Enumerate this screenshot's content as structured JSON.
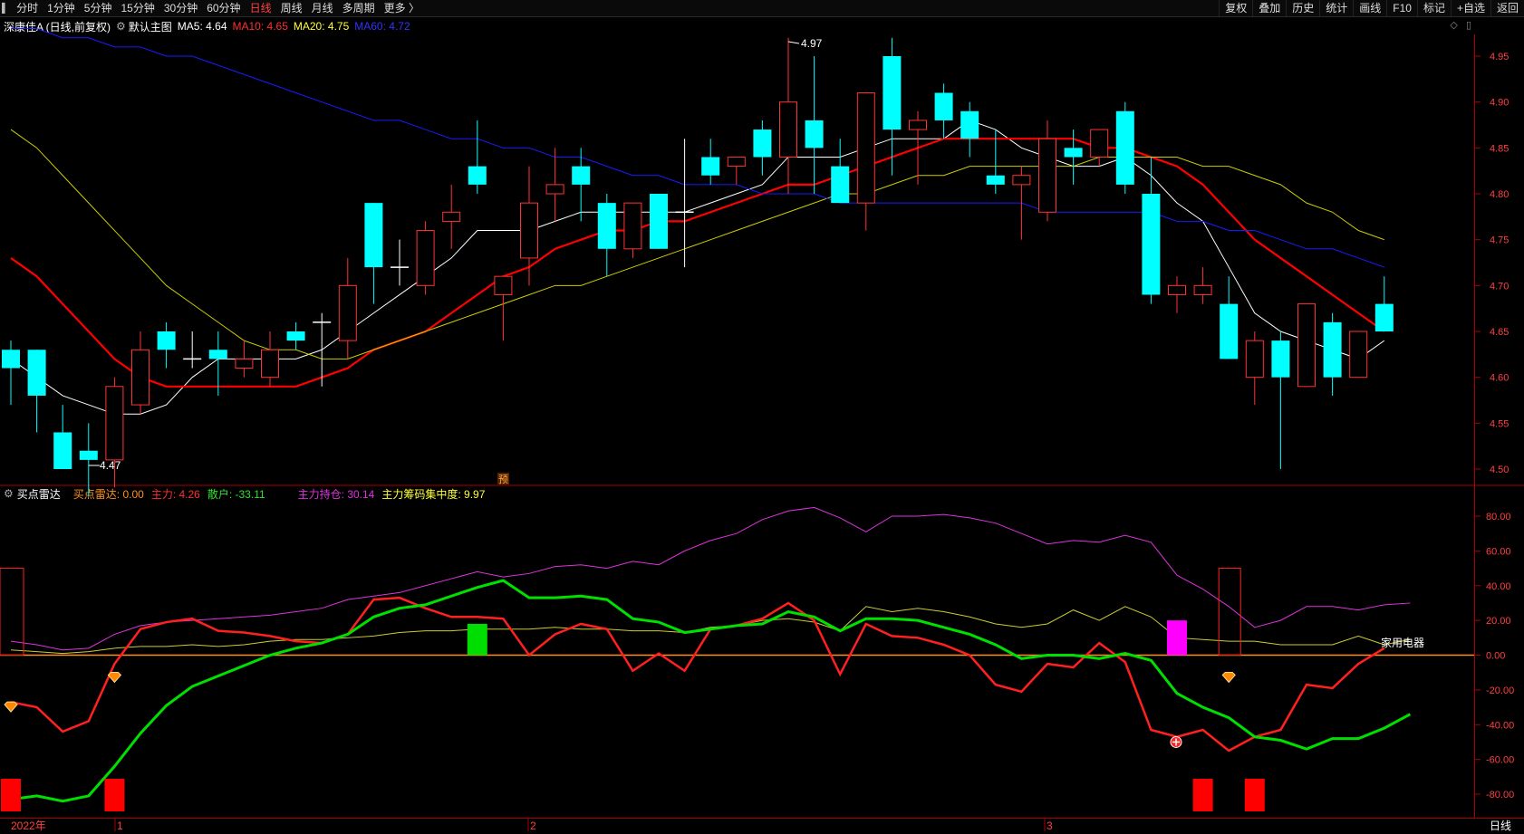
{
  "toolbar": {
    "tabs": [
      "分时",
      "1分钟",
      "5分钟",
      "15分钟",
      "30分钟",
      "60分钟",
      "日线",
      "周线",
      "月线",
      "多周期",
      "更多 〉"
    ],
    "active": "日线",
    "right_buttons": [
      "复权",
      "叠加",
      "历史",
      "统计",
      "画线",
      "F10",
      "标记",
      "+自选",
      "返回"
    ]
  },
  "header": {
    "stock": "深康佳A (日线,前复权)",
    "template": "默认主图",
    "ma5": "MA5: 4.64",
    "ma10": "MA10: 4.65",
    "ma20": "MA20: 4.75",
    "ma60": "MA60: 4.72"
  },
  "indicator_header": {
    "name": "买点雷达",
    "signal": "买点雷达: 0.00",
    "zhuli": "主力: 4.26",
    "sanhu": "散户: -33.11",
    "chicang": "主力持仓: 30.14",
    "jizhong": "主力筹码集中度: 9.97"
  },
  "annotations": {
    "high": "4.97",
    "low": "4.47",
    "pre": "预",
    "sector": "家用电器"
  },
  "bottom": {
    "year": "2022年",
    "months": [
      "1",
      "2",
      "3"
    ],
    "period": "日线"
  },
  "colors": {
    "up": "#ff3333",
    "down": "#00ffff",
    "ma5": "#ffffff",
    "ma10": "#ff0000",
    "ma20": "#cccc00",
    "ma60": "#1a1aff",
    "zhuli": "#ff2020",
    "sanhu": "#00e000",
    "chicang": "#dd33dd",
    "jizhong": "#cccc33",
    "border": "#aa0000"
  },
  "chart_data": [
    {
      "type": "candlestick",
      "price_axis": [
        "4.95",
        "4.90",
        "4.85",
        "4.80",
        "4.75",
        "4.70",
        "4.65",
        "4.60",
        "4.55",
        "4.50"
      ],
      "ylim": [
        4.455,
        5.0
      ],
      "candles": [
        {
          "o": 4.63,
          "h": 4.64,
          "l": 4.57,
          "c": 4.61
        },
        {
          "o": 4.63,
          "h": 4.63,
          "l": 4.54,
          "c": 4.58
        },
        {
          "o": 4.54,
          "h": 4.57,
          "l": 4.5,
          "c": 4.5
        },
        {
          "o": 4.52,
          "h": 4.55,
          "l": 4.47,
          "c": 4.51
        },
        {
          "o": 4.51,
          "h": 4.6,
          "l": 4.48,
          "c": 4.59
        },
        {
          "o": 4.57,
          "h": 4.65,
          "l": 4.56,
          "c": 4.63
        },
        {
          "o": 4.65,
          "h": 4.66,
          "l": 4.61,
          "c": 4.63
        },
        {
          "o": 4.62,
          "h": 4.65,
          "l": 4.61,
          "c": 4.62
        },
        {
          "o": 4.63,
          "h": 4.65,
          "l": 4.58,
          "c": 4.62
        },
        {
          "o": 4.61,
          "h": 4.64,
          "l": 4.6,
          "c": 4.62
        },
        {
          "o": 4.6,
          "h": 4.65,
          "l": 4.59,
          "c": 4.63
        },
        {
          "o": 4.65,
          "h": 4.66,
          "l": 4.63,
          "c": 4.64
        },
        {
          "o": 4.66,
          "h": 4.67,
          "l": 4.59,
          "c": 4.66
        },
        {
          "o": 4.64,
          "h": 4.73,
          "l": 4.62,
          "c": 4.7
        },
        {
          "o": 4.79,
          "h": 4.79,
          "l": 4.68,
          "c": 4.72
        },
        {
          "o": 4.72,
          "h": 4.75,
          "l": 4.7,
          "c": 4.72
        },
        {
          "o": 4.7,
          "h": 4.77,
          "l": 4.69,
          "c": 4.76
        },
        {
          "o": 4.77,
          "h": 4.81,
          "l": 4.74,
          "c": 4.78
        },
        {
          "o": 4.83,
          "h": 4.88,
          "l": 4.8,
          "c": 4.81
        },
        {
          "o": 4.69,
          "h": 4.71,
          "l": 4.64,
          "c": 4.71
        },
        {
          "o": 4.73,
          "h": 4.83,
          "l": 4.7,
          "c": 4.79
        },
        {
          "o": 4.8,
          "h": 4.85,
          "l": 4.77,
          "c": 4.81
        },
        {
          "o": 4.83,
          "h": 4.85,
          "l": 4.77,
          "c": 4.81
        },
        {
          "o": 4.79,
          "h": 4.8,
          "l": 4.71,
          "c": 4.74
        },
        {
          "o": 4.74,
          "h": 4.79,
          "l": 4.73,
          "c": 4.79
        },
        {
          "o": 4.8,
          "h": 4.8,
          "l": 4.74,
          "c": 4.74
        },
        {
          "o": 4.78,
          "h": 4.86,
          "l": 4.72,
          "c": 4.78
        },
        {
          "o": 4.84,
          "h": 4.86,
          "l": 4.81,
          "c": 4.82
        },
        {
          "o": 4.83,
          "h": 4.84,
          "l": 4.81,
          "c": 4.84
        },
        {
          "o": 4.87,
          "h": 4.88,
          "l": 4.82,
          "c": 4.84
        },
        {
          "o": 4.84,
          "h": 4.97,
          "l": 4.8,
          "c": 4.9
        },
        {
          "o": 4.88,
          "h": 4.95,
          "l": 4.8,
          "c": 4.85
        },
        {
          "o": 4.83,
          "h": 4.86,
          "l": 4.79,
          "c": 4.79
        },
        {
          "o": 4.79,
          "h": 4.91,
          "l": 4.76,
          "c": 4.91
        },
        {
          "o": 4.95,
          "h": 4.97,
          "l": 4.82,
          "c": 4.87
        },
        {
          "o": 4.87,
          "h": 4.89,
          "l": 4.81,
          "c": 4.88
        },
        {
          "o": 4.91,
          "h": 4.92,
          "l": 4.86,
          "c": 4.88
        },
        {
          "o": 4.89,
          "h": 4.9,
          "l": 4.84,
          "c": 4.86
        },
        {
          "o": 4.82,
          "h": 4.87,
          "l": 4.8,
          "c": 4.81
        },
        {
          "o": 4.81,
          "h": 4.83,
          "l": 4.75,
          "c": 4.82
        },
        {
          "o": 4.78,
          "h": 4.88,
          "l": 4.77,
          "c": 4.86
        },
        {
          "o": 4.85,
          "h": 4.87,
          "l": 4.81,
          "c": 4.84
        },
        {
          "o": 4.84,
          "h": 4.87,
          "l": 4.83,
          "c": 4.87
        },
        {
          "o": 4.89,
          "h": 4.9,
          "l": 4.8,
          "c": 4.81
        },
        {
          "o": 4.8,
          "h": 4.84,
          "l": 4.68,
          "c": 4.69
        },
        {
          "o": 4.69,
          "h": 4.71,
          "l": 4.67,
          "c": 4.7
        },
        {
          "o": 4.69,
          "h": 4.72,
          "l": 4.68,
          "c": 4.7
        },
        {
          "o": 4.68,
          "h": 4.71,
          "l": 4.62,
          "c": 4.62
        },
        {
          "o": 4.6,
          "h": 4.65,
          "l": 4.57,
          "c": 4.64
        },
        {
          "o": 4.64,
          "h": 4.65,
          "l": 4.5,
          "c": 4.6
        },
        {
          "o": 4.59,
          "h": 4.68,
          "l": 4.59,
          "c": 4.68
        },
        {
          "o": 4.66,
          "h": 4.67,
          "l": 4.58,
          "c": 4.6
        },
        {
          "o": 4.6,
          "h": 4.65,
          "l": 4.6,
          "c": 4.65
        },
        {
          "o": 4.68,
          "h": 4.71,
          "l": 4.65,
          "c": 4.65
        }
      ],
      "series": [
        {
          "name": "MA5",
          "values": [
            4.62,
            4.6,
            4.58,
            4.57,
            4.56,
            4.56,
            4.57,
            4.6,
            4.62,
            4.62,
            4.62,
            4.62,
            4.63,
            4.65,
            4.67,
            4.69,
            4.71,
            4.73,
            4.76,
            4.76,
            4.76,
            4.77,
            4.78,
            4.78,
            4.78,
            4.78,
            4.78,
            4.79,
            4.8,
            4.81,
            4.84,
            4.84,
            4.84,
            4.85,
            4.86,
            4.86,
            4.86,
            4.88,
            4.87,
            4.85,
            4.84,
            4.83,
            4.83,
            4.84,
            4.82,
            4.79,
            4.77,
            4.72,
            4.67,
            4.65,
            4.64,
            4.63,
            4.62,
            4.64
          ]
        },
        {
          "name": "MA10",
          "values": [
            4.73,
            4.71,
            4.68,
            4.65,
            4.62,
            4.6,
            4.59,
            4.59,
            4.59,
            4.59,
            4.59,
            4.59,
            4.6,
            4.61,
            4.63,
            4.64,
            4.65,
            4.67,
            4.69,
            4.71,
            4.72,
            4.74,
            4.75,
            4.76,
            4.76,
            4.77,
            4.77,
            4.78,
            4.79,
            4.8,
            4.81,
            4.81,
            4.82,
            4.83,
            4.84,
            4.85,
            4.86,
            4.86,
            4.86,
            4.86,
            4.86,
            4.86,
            4.85,
            4.85,
            4.84,
            4.83,
            4.81,
            4.78,
            4.75,
            4.73,
            4.71,
            4.69,
            4.67,
            4.65
          ]
        },
        {
          "name": "MA20",
          "values": [
            4.87,
            4.85,
            4.82,
            4.79,
            4.76,
            4.73,
            4.7,
            4.68,
            4.66,
            4.64,
            4.63,
            4.63,
            4.62,
            4.62,
            4.63,
            4.64,
            4.65,
            4.66,
            4.67,
            4.68,
            4.69,
            4.7,
            4.7,
            4.71,
            4.72,
            4.73,
            4.74,
            4.75,
            4.76,
            4.77,
            4.78,
            4.79,
            4.8,
            4.8,
            4.81,
            4.82,
            4.82,
            4.83,
            4.83,
            4.83,
            4.83,
            4.83,
            4.84,
            4.84,
            4.84,
            4.84,
            4.83,
            4.83,
            4.82,
            4.81,
            4.79,
            4.78,
            4.76,
            4.75
          ]
        },
        {
          "name": "MA60",
          "values": [
            4.98,
            4.98,
            4.97,
            4.97,
            4.96,
            4.96,
            4.95,
            4.95,
            4.94,
            4.93,
            4.92,
            4.91,
            4.9,
            4.89,
            4.88,
            4.88,
            4.87,
            4.86,
            4.86,
            4.85,
            4.85,
            4.84,
            4.84,
            4.83,
            4.82,
            4.82,
            4.81,
            4.81,
            4.81,
            4.8,
            4.8,
            4.8,
            4.79,
            4.79,
            4.79,
            4.79,
            4.79,
            4.79,
            4.79,
            4.79,
            4.78,
            4.78,
            4.78,
            4.78,
            4.78,
            4.77,
            4.77,
            4.76,
            4.76,
            4.75,
            4.74,
            4.74,
            4.73,
            4.72
          ]
        }
      ]
    },
    {
      "type": "line",
      "title": "买点雷达",
      "value_axis": [
        "80.00",
        "60.00",
        "40.00",
        "20.00",
        "0.00",
        "-20.00",
        "-40.00",
        "-60.00",
        "-80.00"
      ],
      "ylim": [
        -104,
        100
      ],
      "series": [
        {
          "name": "主力",
          "values": [
            -27,
            -30,
            -44,
            -38,
            -5,
            15,
            19,
            21,
            14,
            13,
            11,
            8,
            7,
            12,
            32,
            33,
            27,
            22,
            22,
            21,
            0,
            12,
            18,
            15,
            -9,
            1,
            -9,
            15,
            17,
            21,
            30,
            20,
            -11,
            18,
            11,
            10,
            6,
            0,
            -17,
            -21,
            -5,
            -7,
            7,
            -4,
            -43,
            -47,
            -43,
            -55,
            -47,
            -43,
            -17,
            -19,
            -5,
            4
          ]
        },
        {
          "name": "散户",
          "values": [
            -83,
            -81,
            -84,
            -81,
            -64,
            -45,
            -29,
            -18,
            -12,
            -6,
            0,
            4,
            7,
            12,
            22,
            27,
            29,
            34,
            39,
            43,
            33,
            33,
            34,
            32,
            21,
            19,
            13,
            15,
            17,
            18,
            25,
            22,
            14,
            21,
            21,
            20,
            16,
            12,
            6,
            -2,
            0,
            0,
            -2,
            1,
            -3,
            -22,
            -30,
            -36,
            -47,
            -49,
            -54,
            -48,
            -48,
            -42,
            -34
          ]
        },
        {
          "name": "主力持仓",
          "values": [
            8,
            6,
            3,
            4,
            12,
            17,
            19,
            20,
            21,
            22,
            23,
            25,
            27,
            32,
            34,
            36,
            40,
            44,
            48,
            45,
            47,
            51,
            52,
            50,
            54,
            52,
            60,
            66,
            70,
            78,
            83,
            85,
            79,
            71,
            80,
            80,
            81,
            79,
            76,
            70,
            64,
            66,
            65,
            69,
            65,
            46,
            38,
            28,
            16,
            20,
            28,
            28,
            26,
            29,
            30
          ]
        },
        {
          "name": "主力筹码集中度",
          "values": [
            3,
            2,
            1,
            2,
            4,
            5,
            5,
            6,
            5,
            6,
            8,
            9,
            9,
            10,
            11,
            13,
            14,
            14,
            15,
            15,
            15,
            16,
            15,
            15,
            14,
            14,
            13,
            16,
            17,
            20,
            21,
            19,
            14,
            28,
            25,
            27,
            25,
            22,
            18,
            16,
            18,
            26,
            20,
            28,
            22,
            10,
            9,
            8,
            8,
            6,
            6,
            6,
            11,
            6,
            9
          ]
        }
      ]
    }
  ]
}
